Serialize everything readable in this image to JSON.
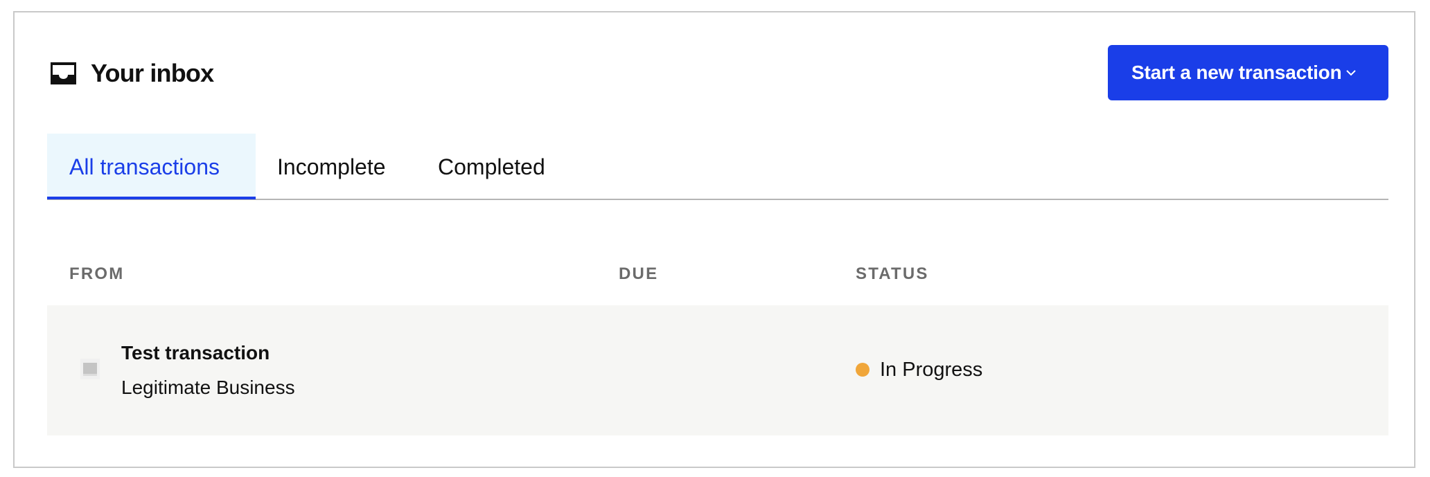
{
  "header": {
    "title": "Your inbox",
    "icon": "inbox-tray-icon"
  },
  "actions": {
    "new_transaction_label": "Start a new transaction",
    "new_transaction_icon": "chevron-down-icon"
  },
  "tabs": [
    {
      "label": "All transactions",
      "active": true
    },
    {
      "label": "Incomplete",
      "active": false
    },
    {
      "label": "Completed",
      "active": false
    }
  ],
  "table": {
    "columns": [
      "FROM",
      "DUE",
      "STATUS"
    ],
    "rows": [
      {
        "title": "Test transaction",
        "from": "Legitimate Business",
        "due": "",
        "status": "In Progress",
        "status_color": "#f0a63a",
        "thumbnail_icon": "document-thumbnail-icon"
      }
    ]
  },
  "colors": {
    "accent": "#1a3ee8",
    "active_tab_bg": "#ebf7fd",
    "row_bg": "#f6f6f4",
    "status_in_progress": "#f0a63a"
  }
}
